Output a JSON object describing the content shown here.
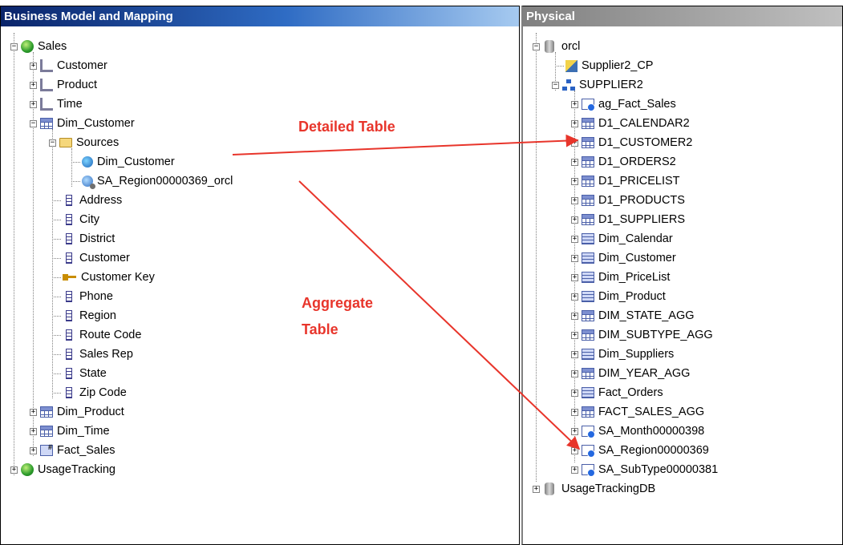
{
  "bmm": {
    "title": "Business Model and Mapping",
    "tree": [
      {
        "label": "Sales",
        "icon": "globe-icon"
      },
      {
        "label": "Customer",
        "icon": "hierarchy-icon"
      },
      {
        "label": "Product",
        "icon": "hierarchy-icon"
      },
      {
        "label": "Time",
        "icon": "hierarchy-icon"
      },
      {
        "label": "Dim_Customer",
        "icon": "logical-table-icon"
      },
      {
        "label": "Sources",
        "icon": "folder-icon"
      },
      {
        "label": "Dim_Customer",
        "icon": "logical-source-icon"
      },
      {
        "label": "SA_Region00000369_orcl",
        "icon": "aggregate-source-icon"
      },
      {
        "label": "Address",
        "icon": "column-icon"
      },
      {
        "label": "City",
        "icon": "column-icon"
      },
      {
        "label": "District",
        "icon": "column-icon"
      },
      {
        "label": "Customer",
        "icon": "column-icon"
      },
      {
        "label": "Customer Key",
        "icon": "key-icon"
      },
      {
        "label": "Phone",
        "icon": "column-icon"
      },
      {
        "label": "Region",
        "icon": "column-icon"
      },
      {
        "label": "Route Code",
        "icon": "column-icon"
      },
      {
        "label": "Sales Rep",
        "icon": "column-icon"
      },
      {
        "label": "State",
        "icon": "column-icon"
      },
      {
        "label": "Zip Code",
        "icon": "column-icon"
      },
      {
        "label": "Dim_Product",
        "icon": "logical-table-icon"
      },
      {
        "label": "Dim_Time",
        "icon": "logical-table-icon"
      },
      {
        "label": "Fact_Sales",
        "icon": "fact-table-icon"
      },
      {
        "label": "UsageTracking",
        "icon": "globe-icon"
      }
    ]
  },
  "physical": {
    "title": "Physical",
    "tree": [
      {
        "label": "orcl",
        "icon": "database-icon"
      },
      {
        "label": "Supplier2_CP",
        "icon": "connection-pool-icon"
      },
      {
        "label": "SUPPLIER2",
        "icon": "schema-icon"
      },
      {
        "label": "ag_Fact_Sales",
        "icon": "alias-table-icon"
      },
      {
        "label": "D1_CALENDAR2",
        "icon": "physical-table-icon"
      },
      {
        "label": "D1_CUSTOMER2",
        "icon": "physical-table-icon"
      },
      {
        "label": "D1_ORDERS2",
        "icon": "physical-table-icon"
      },
      {
        "label": "D1_PRICELIST",
        "icon": "physical-table-icon"
      },
      {
        "label": "D1_PRODUCTS",
        "icon": "physical-table-icon"
      },
      {
        "label": "D1_SUPPLIERS",
        "icon": "physical-table-icon"
      },
      {
        "label": "Dim_Calendar",
        "icon": "view-table-icon"
      },
      {
        "label": "Dim_Customer",
        "icon": "view-table-icon"
      },
      {
        "label": "Dim_PriceList",
        "icon": "view-table-icon"
      },
      {
        "label": "Dim_Product",
        "icon": "view-table-icon"
      },
      {
        "label": "DIM_STATE_AGG",
        "icon": "physical-table-icon"
      },
      {
        "label": "DIM_SUBTYPE_AGG",
        "icon": "physical-table-icon"
      },
      {
        "label": "Dim_Suppliers",
        "icon": "view-table-icon"
      },
      {
        "label": "DIM_YEAR_AGG",
        "icon": "physical-table-icon"
      },
      {
        "label": "Fact_Orders",
        "icon": "view-table-icon"
      },
      {
        "label": "FACT_SALES_AGG",
        "icon": "physical-table-icon"
      },
      {
        "label": "SA_Month00000398",
        "icon": "alias-table-icon"
      },
      {
        "label": "SA_Region00000369",
        "icon": "alias-table-icon"
      },
      {
        "label": "SA_SubType00000381",
        "icon": "alias-table-icon"
      },
      {
        "label": "UsageTrackingDB",
        "icon": "database-icon"
      }
    ]
  },
  "annotations": {
    "detailed": "Detailed Table",
    "aggregate_line1": "Aggregate",
    "aggregate_line2": "Table",
    "arrow_color": "#e8352b"
  }
}
